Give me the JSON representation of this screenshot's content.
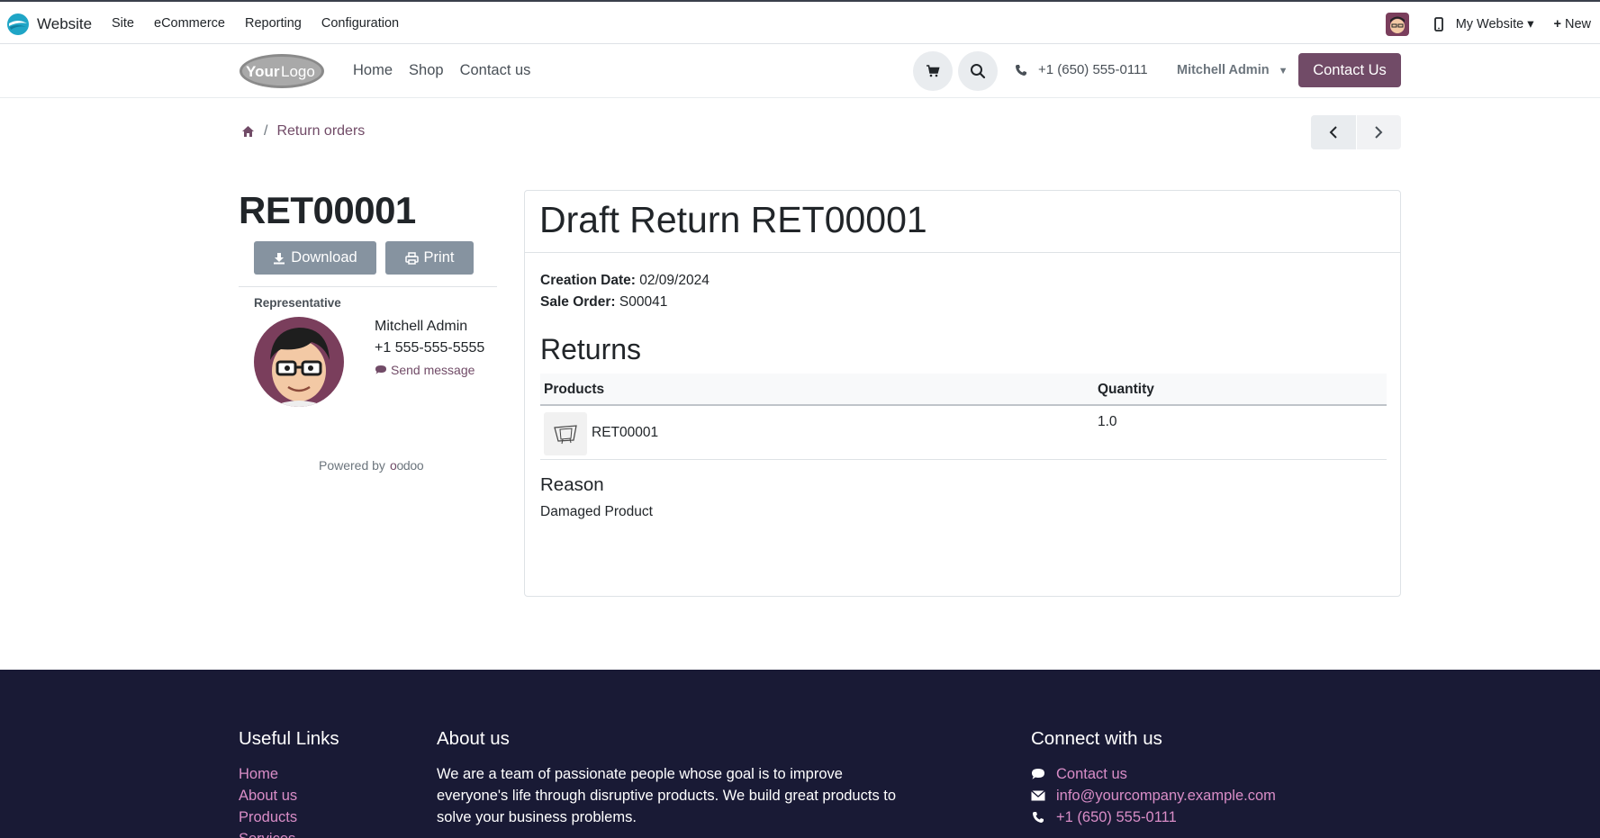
{
  "adminbar": {
    "app_name": "Website",
    "menu": [
      "Site",
      "eCommerce",
      "Reporting",
      "Configuration"
    ],
    "website_selector": "My Website",
    "new_label": "New"
  },
  "header": {
    "nav": [
      "Home",
      "Shop",
      "Contact us"
    ],
    "phone": "+1 (650) 555-0111",
    "user": "Mitchell Admin",
    "contact_button": "Contact Us"
  },
  "breadcrumb": {
    "current": "Return orders"
  },
  "sidebar": {
    "title": "RET00001",
    "download_label": "Download",
    "print_label": "Print",
    "representative_label": "Representative",
    "rep_name": "Mitchell Admin",
    "rep_phone": "+1 555-555-5555",
    "send_message": "Send message",
    "powered_by": "Powered by",
    "odoo": "odoo"
  },
  "main": {
    "title": "Draft Return RET00001",
    "creation_date_label": "Creation Date:",
    "creation_date": "02/09/2024",
    "sale_order_label": "Sale Order:",
    "sale_order": "S00041",
    "returns_heading": "Returns",
    "columns": [
      "Products",
      "Quantity"
    ],
    "rows": [
      {
        "product": "RET00001",
        "quantity": "1.0"
      }
    ],
    "reason_heading": "Reason",
    "reason": "Damaged Product"
  },
  "footer": {
    "useful_links_heading": "Useful Links",
    "useful_links": [
      "Home",
      "About us",
      "Products",
      "Services"
    ],
    "about_heading": "About us",
    "about_text": "We are a team of passionate people whose goal is to improve everyone's life through disruptive products. We build great products to solve your business problems.",
    "connect_heading": "Connect with us",
    "connect": {
      "contact": "Contact us",
      "email": "info@yourcompany.example.com",
      "phone": "+1 (650) 555-0111"
    }
  },
  "colors": {
    "brand": "#714b67",
    "footer_bg": "#191a35",
    "footer_link": "#d98dc7",
    "button_grey": "#8693a0"
  }
}
